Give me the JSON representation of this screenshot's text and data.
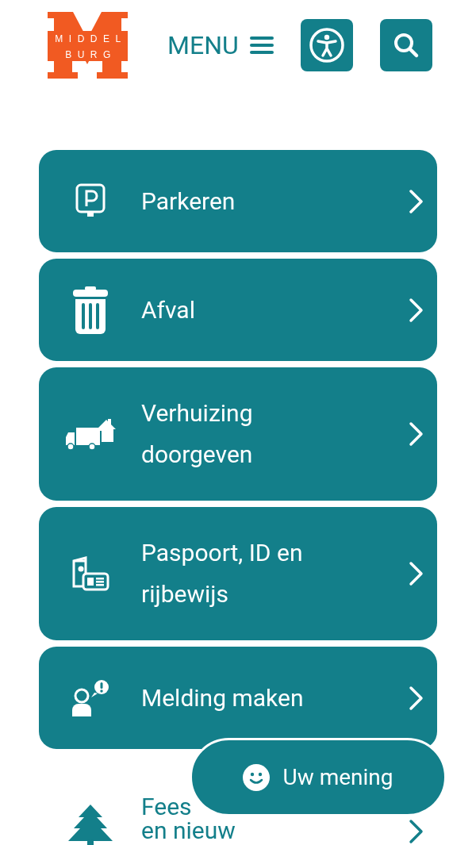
{
  "logo": {
    "line_1": "MIDDEL",
    "line_2": "BURG"
  },
  "header": {
    "menu_label": "MENU"
  },
  "tiles": [
    {
      "kind": "parking",
      "lines": [
        "Parkeren"
      ],
      "filled": true
    },
    {
      "kind": "waste",
      "lines": [
        "Afval"
      ],
      "filled": true
    },
    {
      "kind": "moving",
      "lines": [
        "Verhuizing",
        "doorgeven"
      ],
      "filled": true
    },
    {
      "kind": "id",
      "lines": [
        "Paspoort, ID en",
        "rijbewijs"
      ],
      "filled": true
    },
    {
      "kind": "report",
      "lines": [
        "Melding maken"
      ],
      "filled": true
    },
    {
      "kind": "tree",
      "lines": [
        "Fees",
        "en nieuw"
      ],
      "filled": false
    }
  ],
  "feedback_button": {
    "label": "Uw mening"
  }
}
